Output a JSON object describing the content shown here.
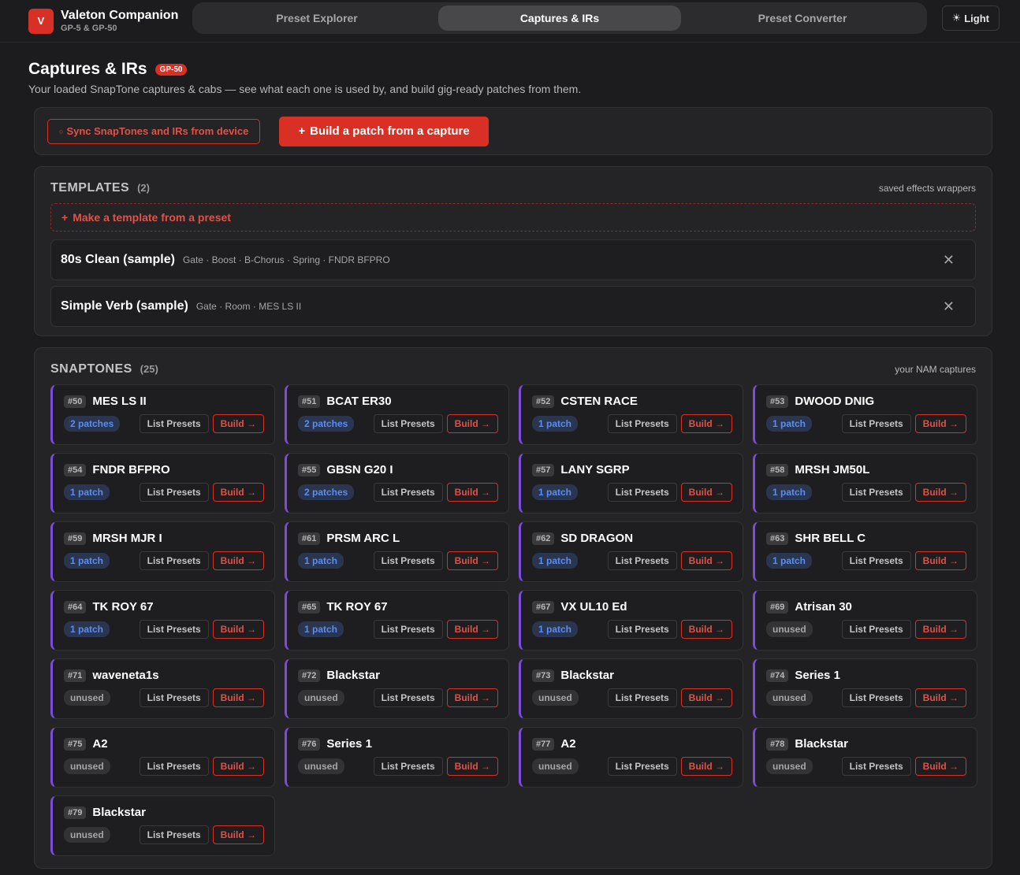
{
  "brand": {
    "logo": "V",
    "name": "Valeton Companion",
    "sub": "GP-5 & GP-50"
  },
  "tabs": [
    {
      "label": "Preset Explorer",
      "active": false
    },
    {
      "label": "Captures & IRs",
      "active": true
    },
    {
      "label": "Preset Converter",
      "active": false
    }
  ],
  "theme_toggle": {
    "icon": "sun-icon",
    "glyph": "☀",
    "label": "Light"
  },
  "page": {
    "title": "Captures & IRs",
    "badge": "GP-50",
    "subtitle": "Your loaded SnapTone captures & cabs — see what each one is used by, and build gig-ready patches from them."
  },
  "actions": {
    "sync_icon": "○",
    "sync_label": "Sync SnapTones and IRs from device",
    "build_icon": "+",
    "build_label": "Build a patch from a capture"
  },
  "templates": {
    "title": "TEMPLATES",
    "count": "(2)",
    "note": "saved effects wrappers",
    "add_icon": "+",
    "add_label": "Make a template from a preset",
    "close_glyph": "✕",
    "items": [
      {
        "name": "80s Clean (sample)",
        "chain": "Gate · Boost · B-Chorus · Spring · FNDR BFPRO"
      },
      {
        "name": "Simple Verb (sample)",
        "chain": "Gate · Room · MES LS II"
      }
    ]
  },
  "snaptones": {
    "title": "SNAPTONES",
    "count": "(25)",
    "note": "your NAM captures",
    "list_label": "List Presets",
    "build_label": "Build →",
    "items": [
      {
        "slot": "#50",
        "name": "MES LS II",
        "usage": "2 patches",
        "used": true
      },
      {
        "slot": "#51",
        "name": "BCAT ER30",
        "usage": "2 patches",
        "used": true
      },
      {
        "slot": "#52",
        "name": "CSTEN RACE",
        "usage": "1 patch",
        "used": true
      },
      {
        "slot": "#53",
        "name": "DWOOD DNIG",
        "usage": "1 patch",
        "used": true
      },
      {
        "slot": "#54",
        "name": "FNDR BFPRO",
        "usage": "1 patch",
        "used": true
      },
      {
        "slot": "#55",
        "name": "GBSN G20 I",
        "usage": "2 patches",
        "used": true
      },
      {
        "slot": "#57",
        "name": "LANY SGRP",
        "usage": "1 patch",
        "used": true
      },
      {
        "slot": "#58",
        "name": "MRSH JM50L",
        "usage": "1 patch",
        "used": true
      },
      {
        "slot": "#59",
        "name": "MRSH MJR I",
        "usage": "1 patch",
        "used": true
      },
      {
        "slot": "#61",
        "name": "PRSM ARC L",
        "usage": "1 patch",
        "used": true
      },
      {
        "slot": "#62",
        "name": "SD DRAGON",
        "usage": "1 patch",
        "used": true
      },
      {
        "slot": "#63",
        "name": "SHR BELL C",
        "usage": "1 patch",
        "used": true
      },
      {
        "slot": "#64",
        "name": "TK ROY 67",
        "usage": "1 patch",
        "used": true
      },
      {
        "slot": "#65",
        "name": "TK ROY 67",
        "usage": "1 patch",
        "used": true
      },
      {
        "slot": "#67",
        "name": "VX UL10 Ed",
        "usage": "1 patch",
        "used": true
      },
      {
        "slot": "#69",
        "name": "Atrisan 30",
        "usage": "unused",
        "used": false
      },
      {
        "slot": "#71",
        "name": "waveneta1s",
        "usage": "unused",
        "used": false
      },
      {
        "slot": "#72",
        "name": "Blackstar",
        "usage": "unused",
        "used": false
      },
      {
        "slot": "#73",
        "name": "Blackstar",
        "usage": "unused",
        "used": false
      },
      {
        "slot": "#74",
        "name": "Series 1",
        "usage": "unused",
        "used": false
      },
      {
        "slot": "#75",
        "name": "A2",
        "usage": "unused",
        "used": false
      },
      {
        "slot": "#76",
        "name": "Series 1",
        "usage": "unused",
        "used": false
      },
      {
        "slot": "#77",
        "name": "A2",
        "usage": "unused",
        "used": false
      },
      {
        "slot": "#78",
        "name": "Blackstar",
        "usage": "unused",
        "used": false
      },
      {
        "slot": "#79",
        "name": "Blackstar",
        "usage": "unused",
        "used": false
      }
    ]
  },
  "colors": {
    "accent": "#d93025",
    "capture_border": "#7c4ddb",
    "used_badge": "#5b8def",
    "background": "#1c1c1e"
  }
}
